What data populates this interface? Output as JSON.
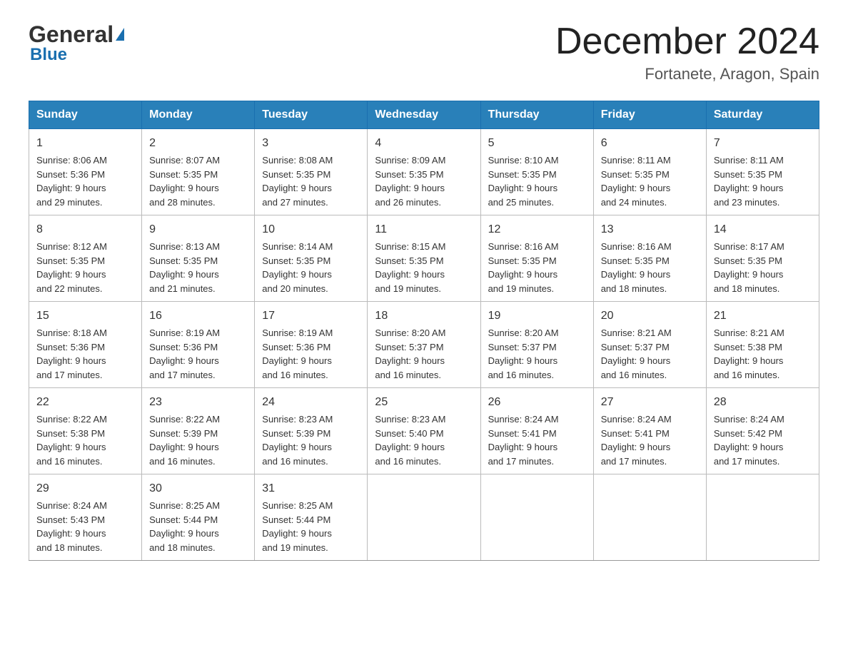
{
  "header": {
    "logo_general": "General",
    "logo_blue": "Blue",
    "month_title": "December 2024",
    "location": "Fortanete, Aragon, Spain"
  },
  "days_of_week": [
    "Sunday",
    "Monday",
    "Tuesday",
    "Wednesday",
    "Thursday",
    "Friday",
    "Saturday"
  ],
  "weeks": [
    [
      {
        "day": "1",
        "sunrise": "8:06 AM",
        "sunset": "5:36 PM",
        "daylight": "9 hours and 29 minutes."
      },
      {
        "day": "2",
        "sunrise": "8:07 AM",
        "sunset": "5:35 PM",
        "daylight": "9 hours and 28 minutes."
      },
      {
        "day": "3",
        "sunrise": "8:08 AM",
        "sunset": "5:35 PM",
        "daylight": "9 hours and 27 minutes."
      },
      {
        "day": "4",
        "sunrise": "8:09 AM",
        "sunset": "5:35 PM",
        "daylight": "9 hours and 26 minutes."
      },
      {
        "day": "5",
        "sunrise": "8:10 AM",
        "sunset": "5:35 PM",
        "daylight": "9 hours and 25 minutes."
      },
      {
        "day": "6",
        "sunrise": "8:11 AM",
        "sunset": "5:35 PM",
        "daylight": "9 hours and 24 minutes."
      },
      {
        "day": "7",
        "sunrise": "8:11 AM",
        "sunset": "5:35 PM",
        "daylight": "9 hours and 23 minutes."
      }
    ],
    [
      {
        "day": "8",
        "sunrise": "8:12 AM",
        "sunset": "5:35 PM",
        "daylight": "9 hours and 22 minutes."
      },
      {
        "day": "9",
        "sunrise": "8:13 AM",
        "sunset": "5:35 PM",
        "daylight": "9 hours and 21 minutes."
      },
      {
        "day": "10",
        "sunrise": "8:14 AM",
        "sunset": "5:35 PM",
        "daylight": "9 hours and 20 minutes."
      },
      {
        "day": "11",
        "sunrise": "8:15 AM",
        "sunset": "5:35 PM",
        "daylight": "9 hours and 19 minutes."
      },
      {
        "day": "12",
        "sunrise": "8:16 AM",
        "sunset": "5:35 PM",
        "daylight": "9 hours and 19 minutes."
      },
      {
        "day": "13",
        "sunrise": "8:16 AM",
        "sunset": "5:35 PM",
        "daylight": "9 hours and 18 minutes."
      },
      {
        "day": "14",
        "sunrise": "8:17 AM",
        "sunset": "5:35 PM",
        "daylight": "9 hours and 18 minutes."
      }
    ],
    [
      {
        "day": "15",
        "sunrise": "8:18 AM",
        "sunset": "5:36 PM",
        "daylight": "9 hours and 17 minutes."
      },
      {
        "day": "16",
        "sunrise": "8:19 AM",
        "sunset": "5:36 PM",
        "daylight": "9 hours and 17 minutes."
      },
      {
        "day": "17",
        "sunrise": "8:19 AM",
        "sunset": "5:36 PM",
        "daylight": "9 hours and 16 minutes."
      },
      {
        "day": "18",
        "sunrise": "8:20 AM",
        "sunset": "5:37 PM",
        "daylight": "9 hours and 16 minutes."
      },
      {
        "day": "19",
        "sunrise": "8:20 AM",
        "sunset": "5:37 PM",
        "daylight": "9 hours and 16 minutes."
      },
      {
        "day": "20",
        "sunrise": "8:21 AM",
        "sunset": "5:37 PM",
        "daylight": "9 hours and 16 minutes."
      },
      {
        "day": "21",
        "sunrise": "8:21 AM",
        "sunset": "5:38 PM",
        "daylight": "9 hours and 16 minutes."
      }
    ],
    [
      {
        "day": "22",
        "sunrise": "8:22 AM",
        "sunset": "5:38 PM",
        "daylight": "9 hours and 16 minutes."
      },
      {
        "day": "23",
        "sunrise": "8:22 AM",
        "sunset": "5:39 PM",
        "daylight": "9 hours and 16 minutes."
      },
      {
        "day": "24",
        "sunrise": "8:23 AM",
        "sunset": "5:39 PM",
        "daylight": "9 hours and 16 minutes."
      },
      {
        "day": "25",
        "sunrise": "8:23 AM",
        "sunset": "5:40 PM",
        "daylight": "9 hours and 16 minutes."
      },
      {
        "day": "26",
        "sunrise": "8:24 AM",
        "sunset": "5:41 PM",
        "daylight": "9 hours and 17 minutes."
      },
      {
        "day": "27",
        "sunrise": "8:24 AM",
        "sunset": "5:41 PM",
        "daylight": "9 hours and 17 minutes."
      },
      {
        "day": "28",
        "sunrise": "8:24 AM",
        "sunset": "5:42 PM",
        "daylight": "9 hours and 17 minutes."
      }
    ],
    [
      {
        "day": "29",
        "sunrise": "8:24 AM",
        "sunset": "5:43 PM",
        "daylight": "9 hours and 18 minutes."
      },
      {
        "day": "30",
        "sunrise": "8:25 AM",
        "sunset": "5:44 PM",
        "daylight": "9 hours and 18 minutes."
      },
      {
        "day": "31",
        "sunrise": "8:25 AM",
        "sunset": "5:44 PM",
        "daylight": "9 hours and 19 minutes."
      },
      null,
      null,
      null,
      null
    ]
  ]
}
